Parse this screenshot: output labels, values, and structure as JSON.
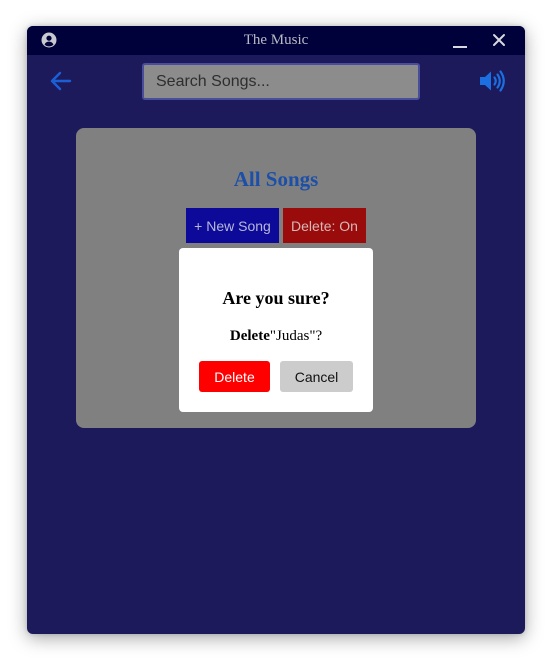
{
  "window": {
    "title": "The Music",
    "icons": {
      "user": "user-circle-icon",
      "minimize": "minimize-icon",
      "close": "close-icon"
    }
  },
  "toolbar": {
    "back_icon": "arrow-left-icon",
    "search": {
      "placeholder": "Search Songs...",
      "value": ""
    },
    "volume_icon": "volume-high-icon"
  },
  "panel": {
    "title": "All Songs",
    "new_song_label": "+ New Song",
    "delete_toggle_label": "Delete: On"
  },
  "dialog": {
    "title": "Are you sure?",
    "message_verb": "Delete",
    "message_target": "\"Judas\"?",
    "confirm_label": "Delete",
    "cancel_label": "Cancel"
  },
  "colors": {
    "background": "#1d1a5c",
    "titlebar": "#00003a",
    "accent": "#1b6fe0",
    "panel": "#808080",
    "panel_title": "#1c4fa8",
    "new_song_button": "#0d0a9a",
    "delete_toggle_button": "#9a0c0c",
    "danger": "#ff0000",
    "cancel_button": "#cccccc"
  }
}
